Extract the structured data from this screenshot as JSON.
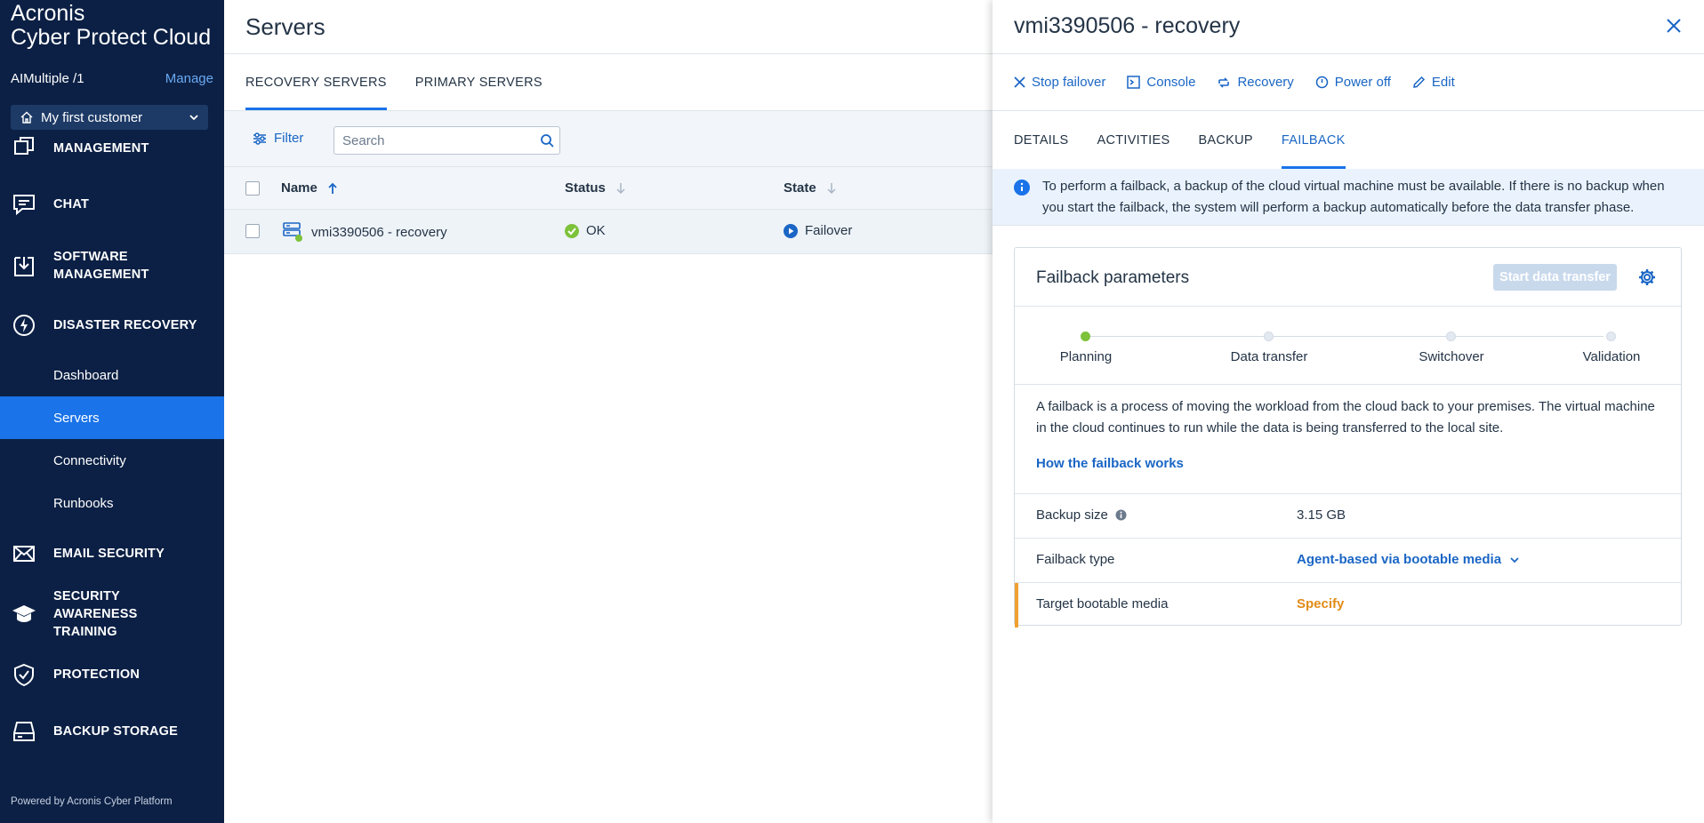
{
  "brand": {
    "line1": "Acronis",
    "line2": "Cyber Protect Cloud"
  },
  "tenant": {
    "name": "AIMultiple /1",
    "manage_label": "Manage"
  },
  "customer_selector": {
    "value": "My first customer"
  },
  "sidebar": {
    "sections": [
      {
        "label": "MANAGEMENT",
        "icon": "management-icon"
      },
      {
        "label": "CHAT",
        "icon": "chat-icon"
      },
      {
        "label": "SOFTWARE MANAGEMENT",
        "icon": "software-icon"
      },
      {
        "label": "DISASTER RECOVERY",
        "icon": "lightning-icon"
      },
      {
        "label": "EMAIL SECURITY",
        "icon": "envelope-icon"
      },
      {
        "label": "SECURITY AWARENESS TRAINING",
        "icon": "graduation-icon"
      },
      {
        "label": "PROTECTION",
        "icon": "shield-icon"
      },
      {
        "label": "BACKUP STORAGE",
        "icon": "storage-icon"
      }
    ],
    "dr_items": [
      {
        "label": "Dashboard"
      },
      {
        "label": "Servers",
        "active": true
      },
      {
        "label": "Connectivity"
      },
      {
        "label": "Runbooks"
      }
    ],
    "powered_by": "Powered by Acronis Cyber Platform",
    "accent_color": "#1a73e8",
    "background_color": "#0c2045"
  },
  "main": {
    "title": "Servers",
    "tabs": [
      {
        "label": "RECOVERY SERVERS",
        "active": true
      },
      {
        "label": "PRIMARY SERVERS"
      }
    ],
    "filter_label": "Filter",
    "search_placeholder": "Search",
    "table": {
      "columns": [
        "Name",
        "Status",
        "State"
      ],
      "rows": [
        {
          "name": "vmi3390506 - recovery",
          "status": "OK",
          "state": "Failover"
        }
      ]
    }
  },
  "panel": {
    "title": "vmi3390506 - recovery",
    "actions": [
      {
        "label": "Stop failover",
        "icon": "close-icon"
      },
      {
        "label": "Console",
        "icon": "console-icon"
      },
      {
        "label": "Recovery",
        "icon": "recovery-icon"
      },
      {
        "label": "Power off",
        "icon": "power-icon"
      },
      {
        "label": "Edit",
        "icon": "pencil-icon"
      }
    ],
    "tabs": [
      {
        "label": "DETAILS"
      },
      {
        "label": "ACTIVITIES"
      },
      {
        "label": "BACKUP"
      },
      {
        "label": "FAILBACK",
        "active": true
      }
    ],
    "info_text": "To perform a failback, a backup of the cloud virtual machine must be available. If there is no backup when you start the failback, the system will perform a backup automatically before the data transfer phase.",
    "card": {
      "title": "Failback parameters",
      "start_button": "Start data transfer",
      "steps": [
        {
          "label": "Planning",
          "done": true
        },
        {
          "label": "Data transfer"
        },
        {
          "label": "Switchover"
        },
        {
          "label": "Validation"
        }
      ],
      "description": "A failback is a process of moving the workload from the cloud back to your premises. The virtual machine in the cloud continues to run while the data is being transferred to the local site.",
      "how_link": "How the failback works",
      "rows": [
        {
          "key": "Backup size",
          "value": "3.15 GB"
        },
        {
          "key": "Failback type",
          "value": "Agent-based via bootable media"
        },
        {
          "key": "Target bootable media",
          "value": "Specify"
        }
      ]
    }
  }
}
